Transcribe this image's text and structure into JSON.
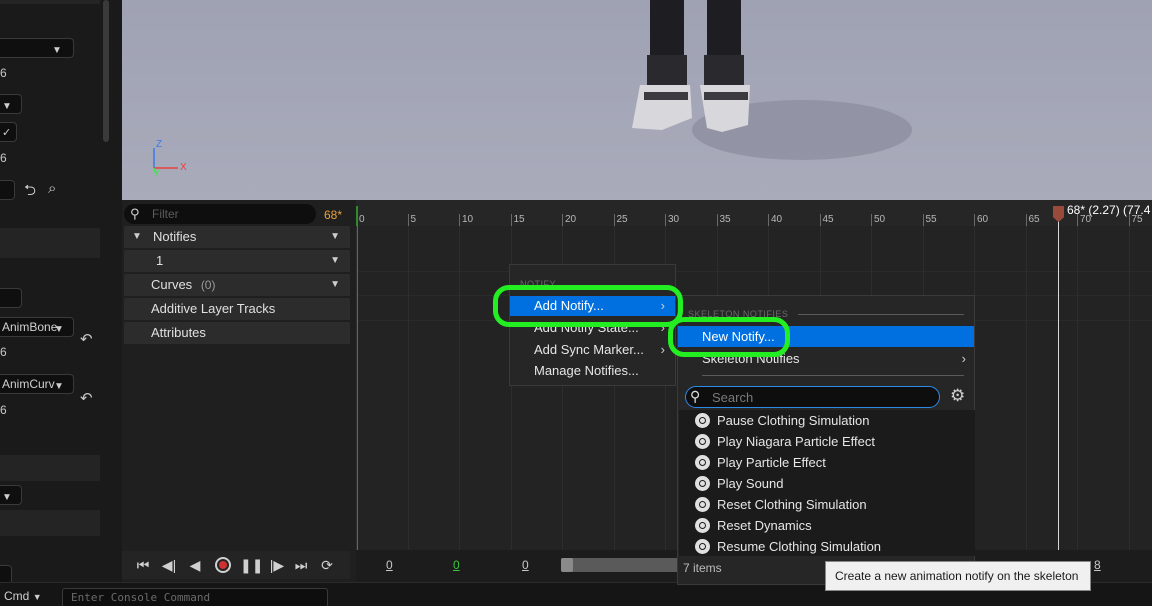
{
  "left_panel": {
    "values": [
      "6",
      "6",
      "6",
      "6"
    ],
    "dropdown_anim_bone": "AnimBone",
    "dropdown_anim_curve": "AnimCurv",
    "reset_icon": "undo-arrow-icon",
    "chevron_icon": "chevron-down-icon"
  },
  "viewport": {
    "axis_labels": {
      "z": "Z",
      "x": "X",
      "y": "Y"
    },
    "colors": {
      "z": "#3b7be8",
      "x": "#e8403b",
      "y": "#3be84b"
    }
  },
  "tracks": {
    "filter_placeholder": "Filter",
    "frame_count": "68*",
    "rows": {
      "notifies": "Notifies",
      "notify_track": "1",
      "curves": "Curves",
      "curves_count": "(0)",
      "additive": "Additive Layer Tracks",
      "attributes": "Attributes"
    }
  },
  "ruler": {
    "ticks": [
      "0",
      "5",
      "10",
      "15",
      "20",
      "25",
      "30",
      "35",
      "40",
      "45",
      "50",
      "55",
      "60",
      "65",
      "70",
      "75"
    ],
    "playhead_label": "68* (2.27) (77.4"
  },
  "scrub": {
    "n1": "0",
    "n2": "0",
    "n3": "0",
    "n4": "8"
  },
  "console": {
    "cmd_label": "Cmd",
    "placeholder": "Enter Console Command"
  },
  "context_menu": {
    "header": "NOTIFY",
    "items": [
      "Add Notify...",
      "Add Notify State...",
      "Add Sync Marker...",
      "Manage Notifies..."
    ]
  },
  "submenu": {
    "header": "SKELETON NOTIFIES",
    "new_notify": "New Notify...",
    "skeleton_notifies": "Skeleton Notifies",
    "search_placeholder": "Search",
    "items": [
      "Pause Clothing Simulation",
      "Play Niagara Particle Effect",
      "Play Particle Effect",
      "Play Sound",
      "Reset Clothing Simulation",
      "Reset Dynamics",
      "Resume Clothing Simulation"
    ],
    "count": "7 items"
  },
  "tooltip": "Create a new animation notify on the skeleton",
  "colors": {
    "accent": "#0070e0",
    "highlight": "#22ee22",
    "frame_count": "#e9a23b"
  }
}
